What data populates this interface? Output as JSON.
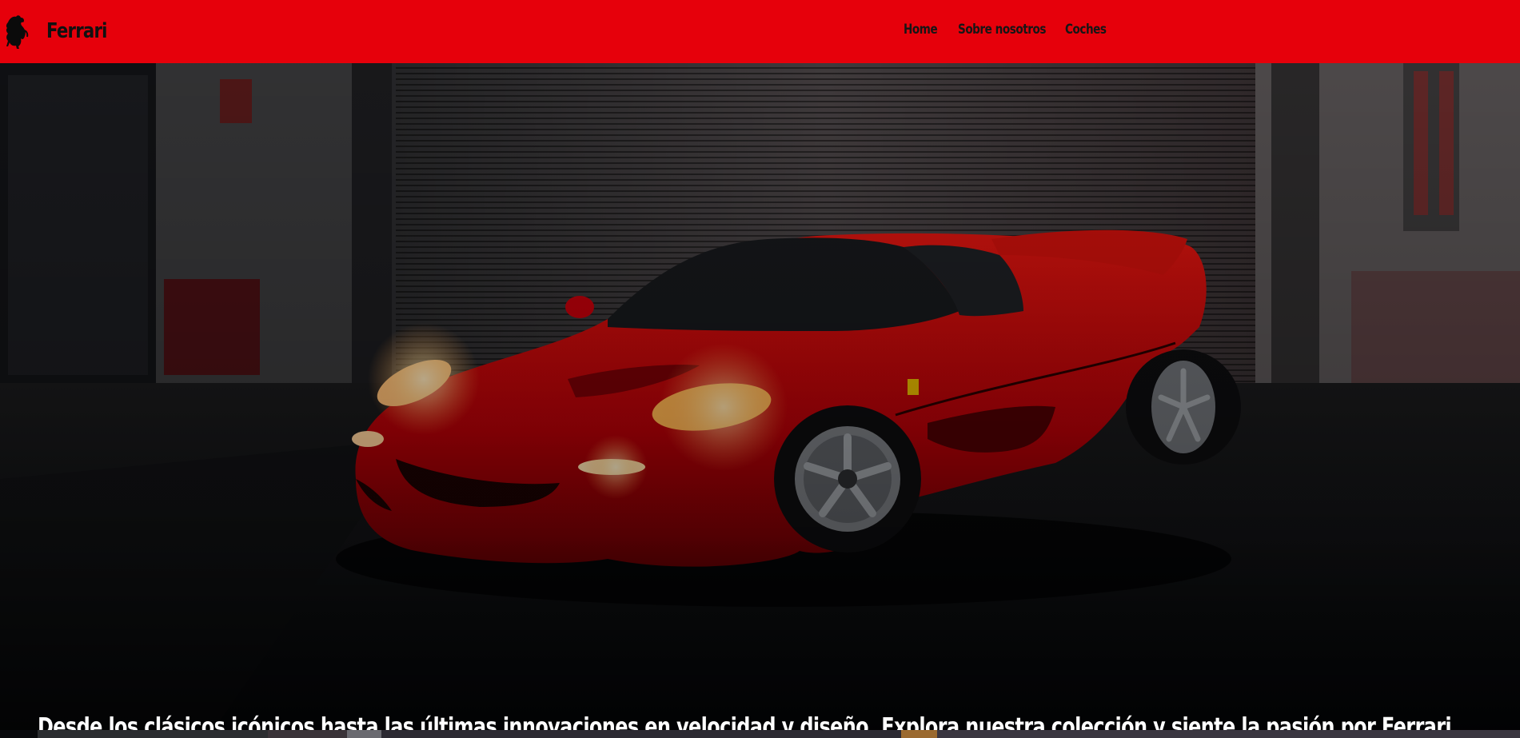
{
  "brand": {
    "name": "Ferrari",
    "logo_icon": "prancing-horse-icon"
  },
  "nav": {
    "links": [
      {
        "label": "Home"
      },
      {
        "label": "Sobre nosotros"
      },
      {
        "label": "Coches"
      }
    ]
  },
  "hero": {
    "image_subject": "red-ferrari-f50-in-garage",
    "tagline": "Desde los clásicos icónicos hasta las últimas innovaciones en velocidad y diseño. Explora nuestra colección y siente la pasión por Ferrari."
  },
  "colors": {
    "navbar": "#e6000b",
    "nav_text": "#161616",
    "hero_overlay": "#05070b",
    "car_red": "#c40008",
    "tagline_text": "#ffffff"
  }
}
